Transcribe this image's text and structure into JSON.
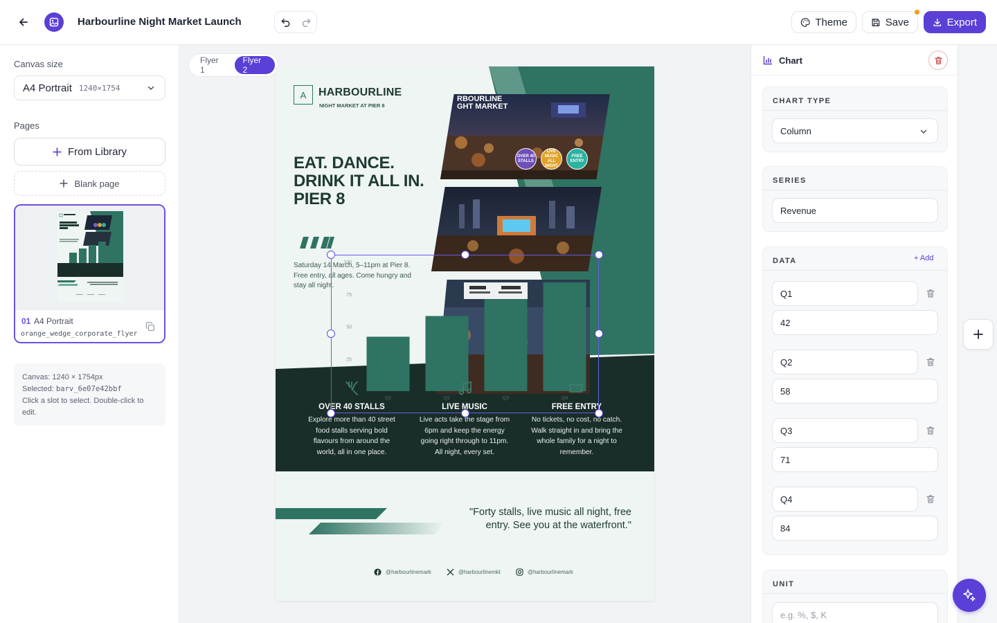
{
  "header": {
    "title": "Harbourline Night Market Launch",
    "theme_label": "Theme",
    "save_label": "Save",
    "export_label": "Export"
  },
  "left": {
    "canvas_size_label": "Canvas size",
    "canvas_size_value": "A4 Portrait",
    "canvas_size_dims": "1240×1754",
    "pages_label": "Pages",
    "from_library": "From Library",
    "blank_page": "Blank page",
    "page": {
      "num": "01",
      "name": "A4 Portrait",
      "template": "orange_wedge_corporate_flyer"
    },
    "info": {
      "canvas": "Canvas: 1240 × 1754px",
      "selected_prefix": "Selected: ",
      "selected_id": "barv_6e07e42bbf",
      "hint": "Click a slot to select. Double-click to edit."
    }
  },
  "canvas": {
    "tabs": [
      "Flyer 1",
      "Flyer 2"
    ],
    "active_tab": 1
  },
  "flyer": {
    "logo_letter": "A",
    "brand": "HARBOURLINE",
    "brand_sub": "NIGHT MARKET AT PIER 8",
    "headline": [
      "EAT. DANCE.",
      "DRINK IT ALL IN.",
      "PIER 8"
    ],
    "intro": "Saturday 14 March, 5–11pm at Pier 8. Free entry, all ages. Come hungry and stay all night.",
    "photo1_text": [
      "RBOURLINE",
      "GHT MARKET"
    ],
    "badges": [
      "OVER 40 STALLS",
      "LIVE MUSIC ALL NIGHT",
      "FREE ENTRY"
    ],
    "features": [
      {
        "title": "OVER 40 STALLS",
        "text": "Explore more than 40 street food stalls serving bold flavours from around the world, all in one place."
      },
      {
        "title": "LIVE MUSIC",
        "text": "Live acts take the stage from 6pm and keep the energy going right through to 11pm. All night, every set."
      },
      {
        "title": "FREE ENTRY",
        "text": "No tickets, no cost, no catch. Walk straight in and bring the whole family for a night to remember."
      }
    ],
    "quote": "\"Forty stalls, live music all night, free entry. See you at the waterfront.\"",
    "socials": [
      {
        "icon": "facebook-icon",
        "handle": "@harbourlinemark"
      },
      {
        "icon": "x-icon",
        "handle": "@harbourlinemkt"
      },
      {
        "icon": "instagram-icon",
        "handle": "@harbourlinemark"
      }
    ],
    "colors": {
      "primary": "#2f7363",
      "dark": "#1a2e29",
      "background": "#eef5f2"
    }
  },
  "chart_data": {
    "type": "bar",
    "categories": [
      "Q1",
      "Q2",
      "Q3",
      "Q4"
    ],
    "series": [
      {
        "name": "Revenue",
        "values": [
          42,
          58,
          71,
          84
        ]
      }
    ],
    "y_ticks": [
      25,
      50,
      75,
      100
    ],
    "ylim": [
      0,
      100
    ],
    "color": "#2f7363"
  },
  "right": {
    "panel_title": "Chart",
    "chart_type_label": "CHART TYPE",
    "chart_type_value": "Column",
    "series_label": "SERIES",
    "series_value": "Revenue",
    "data_label": "DATA",
    "add_label": "+ Add",
    "rows": [
      {
        "label": "Q1",
        "value": "42"
      },
      {
        "label": "Q2",
        "value": "58"
      },
      {
        "label": "Q3",
        "value": "71"
      },
      {
        "label": "Q4",
        "value": "84"
      }
    ],
    "unit_label": "UNIT",
    "unit_placeholder": "e.g. %, $, K"
  }
}
